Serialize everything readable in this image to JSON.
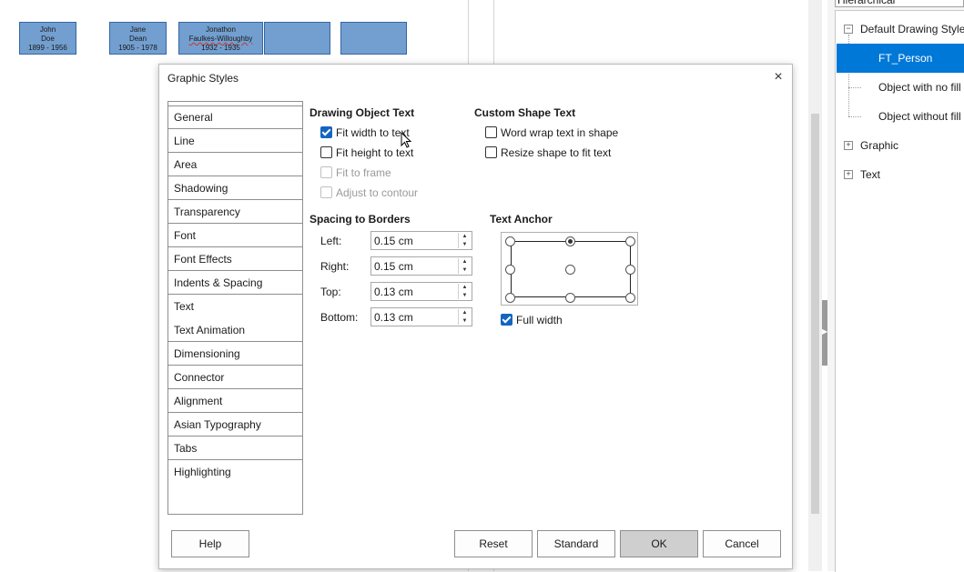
{
  "canvas": {
    "boxes": [
      {
        "lines": [
          "John",
          "Doe",
          "1899 - 1956"
        ]
      },
      {
        "lines": [
          "Jane",
          "Dean",
          "1905 - 1978"
        ]
      },
      {
        "lines": [
          "Jonathon",
          "Faulkes-Willoughby",
          "1932 - 1935"
        ]
      },
      {
        "lines": []
      },
      {
        "lines": []
      }
    ]
  },
  "sidebar": {
    "combo_value": "Hierarchical",
    "tree": [
      {
        "label": "Default Drawing Style",
        "expander": "−"
      },
      {
        "label": "FT_Person",
        "selected": true
      },
      {
        "label": "Object with no fill"
      },
      {
        "label": "Object without fill"
      },
      {
        "label": "Graphic",
        "expander": "+"
      },
      {
        "label": "Text",
        "expander": "+"
      }
    ]
  },
  "dialog": {
    "title": "Graphic Styles",
    "close_icon": "×",
    "nav_items": [
      "General",
      "Line",
      "Area",
      "Shadowing",
      "Transparency",
      "Font",
      "Font Effects",
      "Indents & Spacing",
      "Text",
      "Text Animation",
      "Dimensioning",
      "Connector",
      "Alignment",
      "Asian Typography",
      "Tabs",
      "Highlighting"
    ],
    "drawing_object_text": {
      "heading": "Drawing Object Text",
      "options": [
        {
          "label": "Fit width to text",
          "checked": true,
          "disabled": false
        },
        {
          "label": "Fit height to text",
          "checked": false,
          "disabled": false
        },
        {
          "label": "Fit to frame",
          "checked": false,
          "disabled": true
        },
        {
          "label": "Adjust to contour",
          "checked": false,
          "disabled": true
        }
      ]
    },
    "custom_shape_text": {
      "heading": "Custom Shape Text",
      "options": [
        {
          "label": "Word wrap text in shape",
          "checked": false
        },
        {
          "label": "Resize shape to fit text",
          "checked": false
        }
      ]
    },
    "spacing": {
      "heading": "Spacing to Borders",
      "fields": [
        {
          "label": "Left:",
          "value": "0.15 cm"
        },
        {
          "label": "Right:",
          "value": "0.15 cm"
        },
        {
          "label": "Top:",
          "value": "0.13 cm"
        },
        {
          "label": "Bottom:",
          "value": "0.13 cm"
        }
      ]
    },
    "text_anchor": {
      "heading": "Text Anchor",
      "selected": "top-center",
      "full_width_label": "Full width",
      "full_width_checked": true
    },
    "buttons": {
      "help": "Help",
      "reset": "Reset",
      "standard": "Standard",
      "ok": "OK",
      "cancel": "Cancel"
    }
  },
  "colors": {
    "accent": "#0078d7",
    "box_fill": "#729fcf",
    "checkbox_checked": "#1565c0"
  }
}
